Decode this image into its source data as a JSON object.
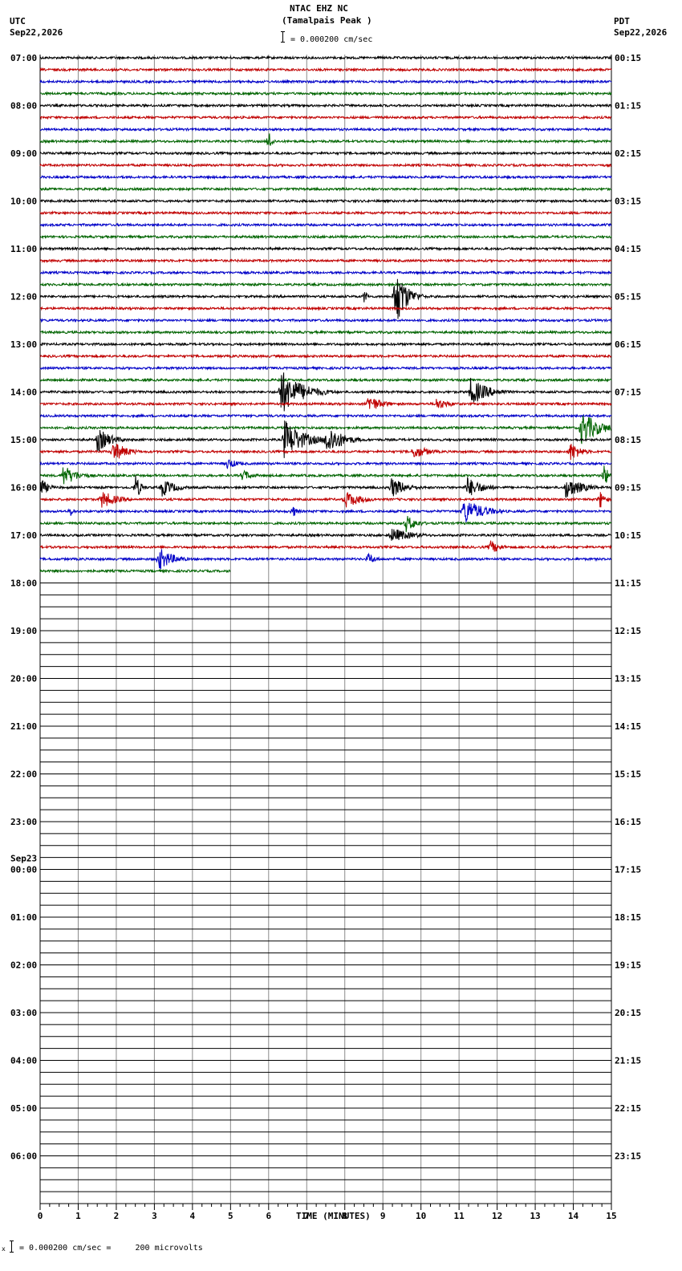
{
  "header": {
    "station": "NTAC EHZ NC",
    "location": "(Tamalpais Peak )",
    "scale": "= 0.000200 cm/sec",
    "left_tz": "UTC",
    "left_date": "Sep22,2026",
    "right_tz": "PDT",
    "right_date": "Sep22,2026"
  },
  "footer": {
    "prefix": "x",
    "scale_text": "= 0.000200 cm/sec =     200 microvolts"
  },
  "chart_data": {
    "type": "line",
    "title": "NTAC EHZ NC (Tamalpais Peak )",
    "xlabel": "TIME (MINUTES)",
    "xlim": [
      0,
      15
    ],
    "x_ticks": [
      "0",
      "1",
      "2",
      "3",
      "4",
      "5",
      "6",
      "7",
      "8",
      "9",
      "10",
      "11",
      "12",
      "13",
      "14",
      "15"
    ],
    "grid": true,
    "trace_colors": [
      "#000000",
      "#c00000",
      "#0000c8",
      "#006400"
    ],
    "traces_per_hour": 4,
    "total_rows": 96,
    "rows_recorded": 44,
    "left_hour_labels": [
      "07:00",
      "08:00",
      "09:00",
      "10:00",
      "11:00",
      "12:00",
      "13:00",
      "14:00",
      "15:00",
      "16:00",
      "17:00",
      "18:00",
      "19:00",
      "20:00",
      "21:00",
      "22:00",
      "23:00",
      "00:00",
      "01:00",
      "02:00",
      "03:00",
      "04:00",
      "05:00",
      "06:00"
    ],
    "date_change": {
      "hour_index": 17,
      "label": "Sep23"
    },
    "right_hour_labels": [
      "00:15",
      "01:15",
      "02:15",
      "03:15",
      "04:15",
      "05:15",
      "06:15",
      "07:15",
      "08:15",
      "09:15",
      "10:15",
      "11:15",
      "12:15",
      "13:15",
      "14:15",
      "15:15",
      "16:15",
      "17:15",
      "18:15",
      "19:15",
      "20:15",
      "21:15",
      "22:15",
      "23:15"
    ],
    "last_row_end_minute": 5,
    "events": [
      {
        "row": 7,
        "minute": 6.0,
        "amplitude": 18,
        "duration": 0.1
      },
      {
        "row": 20,
        "minute": 9.3,
        "amplitude": 45,
        "duration": 0.6
      },
      {
        "row": 20,
        "minute": 8.5,
        "amplitude": 10,
        "duration": 0.2
      },
      {
        "row": 28,
        "minute": 6.3,
        "amplitude": 30,
        "duration": 1.2
      },
      {
        "row": 28,
        "minute": 11.3,
        "amplitude": 18,
        "duration": 1.0
      },
      {
        "row": 29,
        "minute": 8.6,
        "amplitude": 12,
        "duration": 0.8
      },
      {
        "row": 29,
        "minute": 10.4,
        "amplitude": 8,
        "duration": 0.8
      },
      {
        "row": 31,
        "minute": 14.2,
        "amplitude": 22,
        "duration": 1.0
      },
      {
        "row": 32,
        "minute": 1.5,
        "amplitude": 16,
        "duration": 0.8
      },
      {
        "row": 32,
        "minute": 6.4,
        "amplitude": 26,
        "duration": 1.1
      },
      {
        "row": 32,
        "minute": 7.5,
        "amplitude": 22,
        "duration": 0.9
      },
      {
        "row": 33,
        "minute": 1.9,
        "amplitude": 14,
        "duration": 0.8
      },
      {
        "row": 33,
        "minute": 9.8,
        "amplitude": 10,
        "duration": 0.8
      },
      {
        "row": 33,
        "minute": 13.9,
        "amplitude": 14,
        "duration": 0.6
      },
      {
        "row": 34,
        "minute": 4.9,
        "amplitude": 8,
        "duration": 0.6
      },
      {
        "row": 35,
        "minute": 0.6,
        "amplitude": 14,
        "duration": 0.8
      },
      {
        "row": 35,
        "minute": 5.3,
        "amplitude": 8,
        "duration": 0.6
      },
      {
        "row": 35,
        "minute": 14.8,
        "amplitude": 20,
        "duration": 0.2
      },
      {
        "row": 36,
        "minute": 0.0,
        "amplitude": 14,
        "duration": 0.4
      },
      {
        "row": 36,
        "minute": 2.5,
        "amplitude": 18,
        "duration": 0.3
      },
      {
        "row": 36,
        "minute": 3.2,
        "amplitude": 12,
        "duration": 0.8
      },
      {
        "row": 36,
        "minute": 9.2,
        "amplitude": 14,
        "duration": 0.9
      },
      {
        "row": 36,
        "minute": 11.2,
        "amplitude": 14,
        "duration": 0.9
      },
      {
        "row": 36,
        "minute": 13.8,
        "amplitude": 14,
        "duration": 1.0
      },
      {
        "row": 37,
        "minute": 1.6,
        "amplitude": 12,
        "duration": 0.9
      },
      {
        "row": 37,
        "minute": 8.0,
        "amplitude": 12,
        "duration": 0.9
      },
      {
        "row": 37,
        "minute": 14.7,
        "amplitude": 12,
        "duration": 0.3
      },
      {
        "row": 38,
        "minute": 0.8,
        "amplitude": 8,
        "duration": 0.2
      },
      {
        "row": 38,
        "minute": 6.6,
        "amplitude": 10,
        "duration": 0.3
      },
      {
        "row": 38,
        "minute": 11.1,
        "amplitude": 18,
        "duration": 1.1
      },
      {
        "row": 39,
        "minute": 9.6,
        "amplitude": 12,
        "duration": 0.6
      },
      {
        "row": 40,
        "minute": 9.2,
        "amplitude": 10,
        "duration": 1.2
      },
      {
        "row": 41,
        "minute": 11.8,
        "amplitude": 10,
        "duration": 0.6
      },
      {
        "row": 42,
        "minute": 3.1,
        "amplitude": 16,
        "duration": 0.8
      },
      {
        "row": 42,
        "minute": 8.6,
        "amplitude": 8,
        "duration": 0.5
      }
    ]
  }
}
